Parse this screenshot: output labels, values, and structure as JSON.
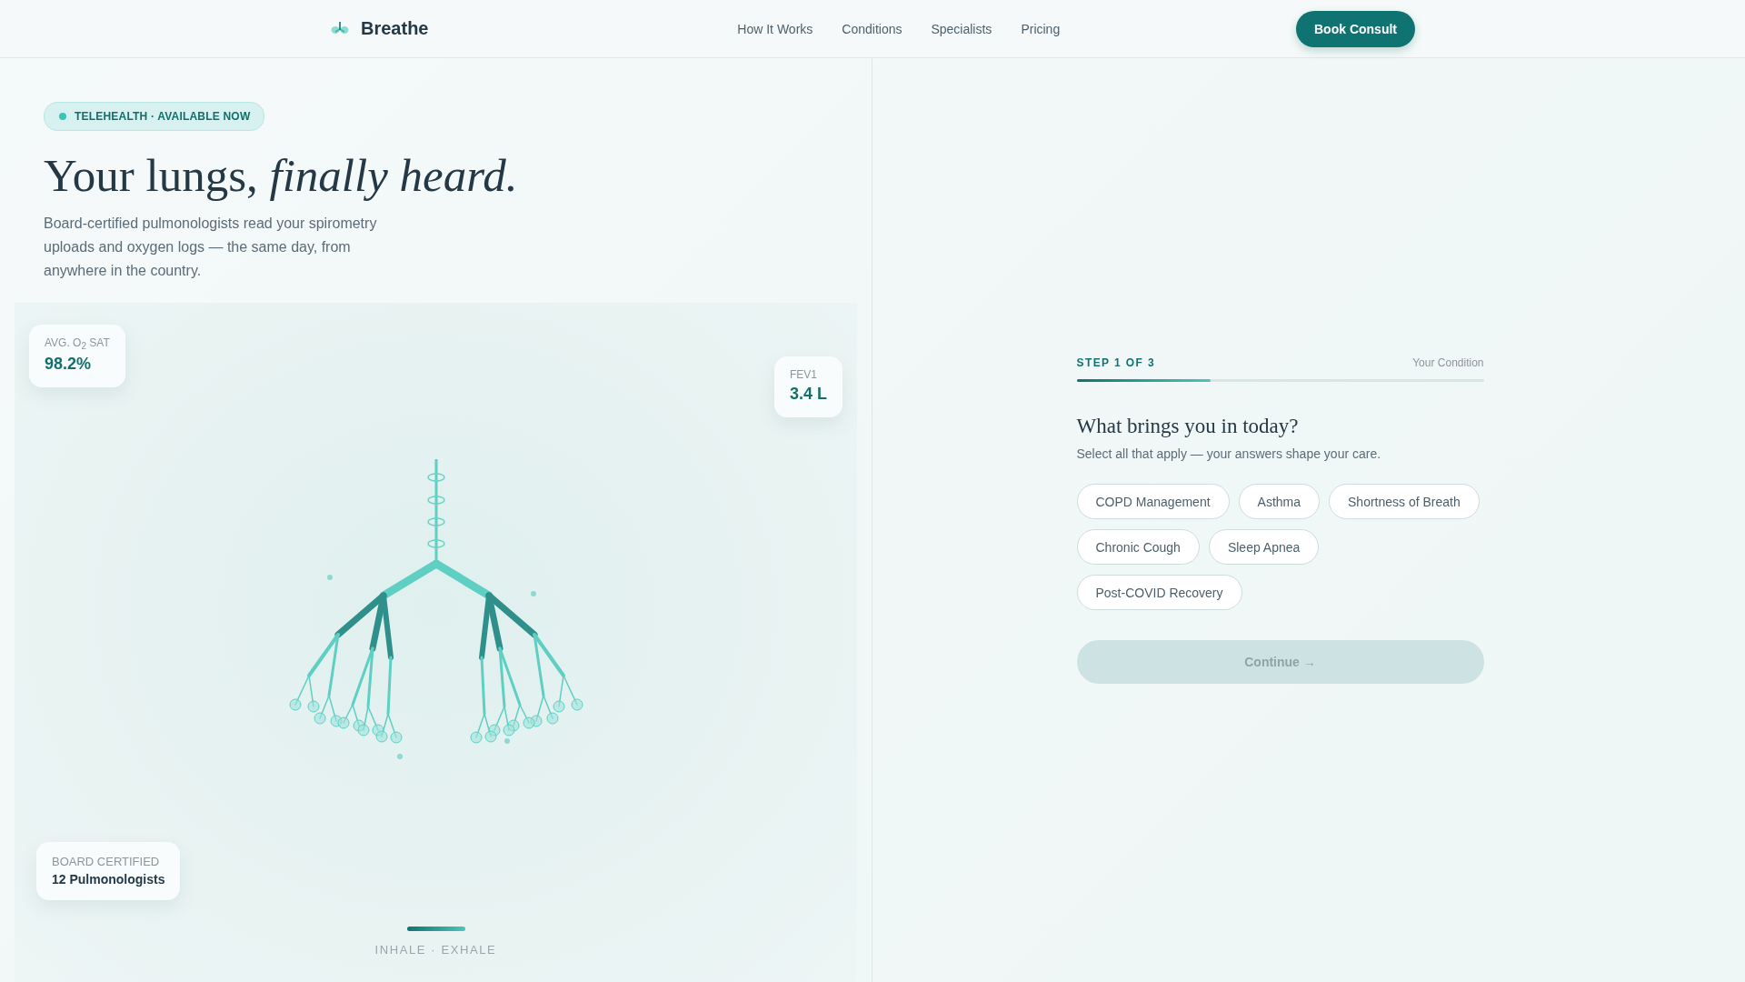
{
  "brand": {
    "name": "Breathe"
  },
  "nav": [
    {
      "label": "How It Works"
    },
    {
      "label": "Conditions"
    },
    {
      "label": "Specialists"
    },
    {
      "label": "Pricing"
    }
  ],
  "cta": "Book Consult",
  "hero": {
    "badge": "TELEHEALTH · AVAILABLE NOW",
    "title": "Your lungs, *finally heard.*",
    "lede": "Board-certified pulmonologists read your spirometry uploads and oxygen logs — the same day, from anywhere in the country."
  },
  "stats": [
    {
      "kind": "metric",
      "label": "AVG. O$_{2}$ SAT",
      "value": "98.2%"
    },
    {
      "kind": "metric",
      "label": "FEV1",
      "value": "3.4 L"
    },
    {
      "kind": "credential",
      "label": "BOARD CERTIFIED",
      "value": "12 Pulmonologists"
    }
  ],
  "breath_label": "INHALE · EXHALE",
  "form": {
    "step": "STEP 1 OF 3",
    "step_name": "Your Condition",
    "progress": {
      "level": 0.33
    },
    "question": "What brings you in today?",
    "hint": "Select all that apply — your answers shape your care.",
    "options": [
      {
        "label": "COPD Management",
        "selected": false
      },
      {
        "label": "Asthma",
        "selected": false
      },
      {
        "label": "Shortness of Breath",
        "selected": false
      },
      {
        "label": "Chronic Cough",
        "selected": false
      },
      {
        "label": "Sleep Apnea",
        "selected": false
      },
      {
        "label": "Post-COVID Recovery",
        "selected": false
      }
    ],
    "continue": {
      "label": "Continue →",
      "disabled": true
    }
  }
}
